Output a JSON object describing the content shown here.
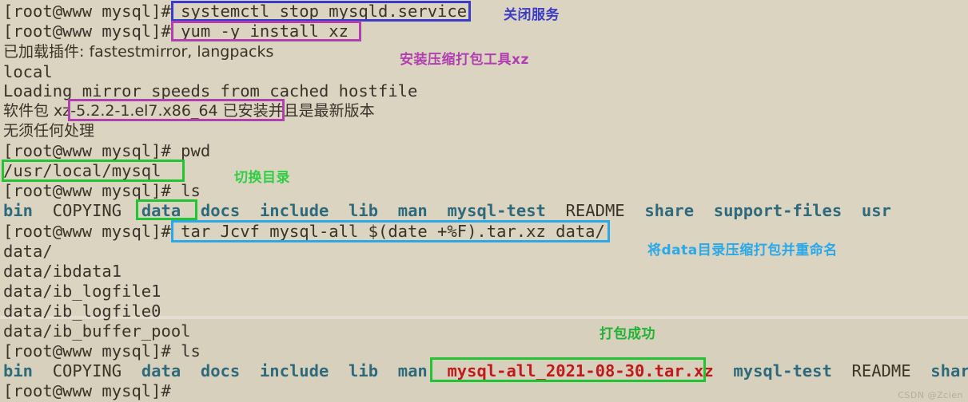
{
  "terminal": {
    "prompt": "[root@www mysql]#",
    "lines": [
      {
        "id": "l1",
        "text": "[root@www mysql]# systemctl stop mysqld.service"
      },
      {
        "id": "l2",
        "text": "[root@www mysql]# yum -y install xz"
      },
      {
        "id": "l3",
        "text": "已加载插件: fastestmirror, langpacks"
      },
      {
        "id": "l4",
        "text": "local"
      },
      {
        "id": "l5",
        "text": "Loading mirror speeds from cached hostfile"
      },
      {
        "id": "l6",
        "text": "软件包 xz-5.2.2-1.el7.x86_64 已安装并且是最新版本"
      },
      {
        "id": "l7",
        "text": "无须任何处理"
      },
      {
        "id": "l8",
        "text": "[root@www mysql]# pwd"
      },
      {
        "id": "l9",
        "text": "/usr/local/mysql"
      },
      {
        "id": "l10",
        "text": "[root@www mysql]# ls"
      },
      {
        "id": "l12",
        "text": "[root@www mysql]# tar Jcvf mysql-all_$(date +%F).tar.xz data/"
      },
      {
        "id": "l13",
        "text": "data/"
      },
      {
        "id": "l14",
        "text": "data/ibdata1"
      },
      {
        "id": "l15",
        "text": "data/ib_logfile1"
      },
      {
        "id": "l16",
        "text": "data/ib_logfile0"
      },
      {
        "id": "l17",
        "text": "data/ib_buffer_pool"
      },
      {
        "id": "l18",
        "text": "[root@www mysql]# ls"
      },
      {
        "id": "l20",
        "text": "[root@www mysql]#"
      }
    ],
    "ls_first": [
      {
        "name": "bin",
        "kind": "dir"
      },
      {
        "name": "COPYING",
        "kind": "file"
      },
      {
        "name": "data",
        "kind": "dir"
      },
      {
        "name": "docs",
        "kind": "dir"
      },
      {
        "name": "include",
        "kind": "dir"
      },
      {
        "name": "lib",
        "kind": "dir"
      },
      {
        "name": "man",
        "kind": "dir"
      },
      {
        "name": "mysql-test",
        "kind": "dir"
      },
      {
        "name": "README",
        "kind": "file"
      },
      {
        "name": "share",
        "kind": "dir"
      },
      {
        "name": "support-files",
        "kind": "dir"
      },
      {
        "name": "usr",
        "kind": "dir"
      }
    ],
    "ls_second": [
      {
        "name": "bin",
        "kind": "dir"
      },
      {
        "name": "COPYING",
        "kind": "file"
      },
      {
        "name": "data",
        "kind": "dir"
      },
      {
        "name": "docs",
        "kind": "dir"
      },
      {
        "name": "include",
        "kind": "dir"
      },
      {
        "name": "lib",
        "kind": "dir"
      },
      {
        "name": "man",
        "kind": "dir"
      },
      {
        "name": "mysql-all_2021-08-30.tar.xz",
        "kind": "archive"
      },
      {
        "name": "mysql-test",
        "kind": "dir"
      },
      {
        "name": "README",
        "kind": "file"
      },
      {
        "name": "share",
        "kind": "dir"
      }
    ]
  },
  "annotations": [
    {
      "id": "a1",
      "label": "关闭服务",
      "color": "#3b3bc9"
    },
    {
      "id": "a2",
      "label": "安装压缩打包工具xz",
      "color": "#b03fb0"
    },
    {
      "id": "a3",
      "label": "切换目录",
      "color": "#2fcf44"
    },
    {
      "id": "a4",
      "label": "将data目录压缩打包并重命名",
      "color": "#2aa8e8"
    },
    {
      "id": "a5",
      "label": "打包成功",
      "color": "#22b233"
    }
  ],
  "highlights": {
    "systemctl_cmd": "systemctl stop mysqld.service",
    "yum_cmd": "yum -y install xz",
    "package_name": "xz-5.2.2-1.el7.x86_64",
    "pwd_result": "/usr/local/mysql",
    "data_dir": "data",
    "tar_cmd": "tar Jcvf mysql-all_$(date +%F).tar.xz data/",
    "archive_name": "mysql-all_2021-08-30.tar.xz"
  },
  "colors": {
    "background": "#d6d0bc",
    "background_top": "#dad4c1",
    "text": "#3b3229",
    "dir": "#2f6a7c",
    "archive": "#c01a1a",
    "blue": "#3b3bc9",
    "magenta": "#b03fb0",
    "green": "#22c434",
    "cyan": "#2aa8e8"
  },
  "watermark": "CSDN @Zcien"
}
